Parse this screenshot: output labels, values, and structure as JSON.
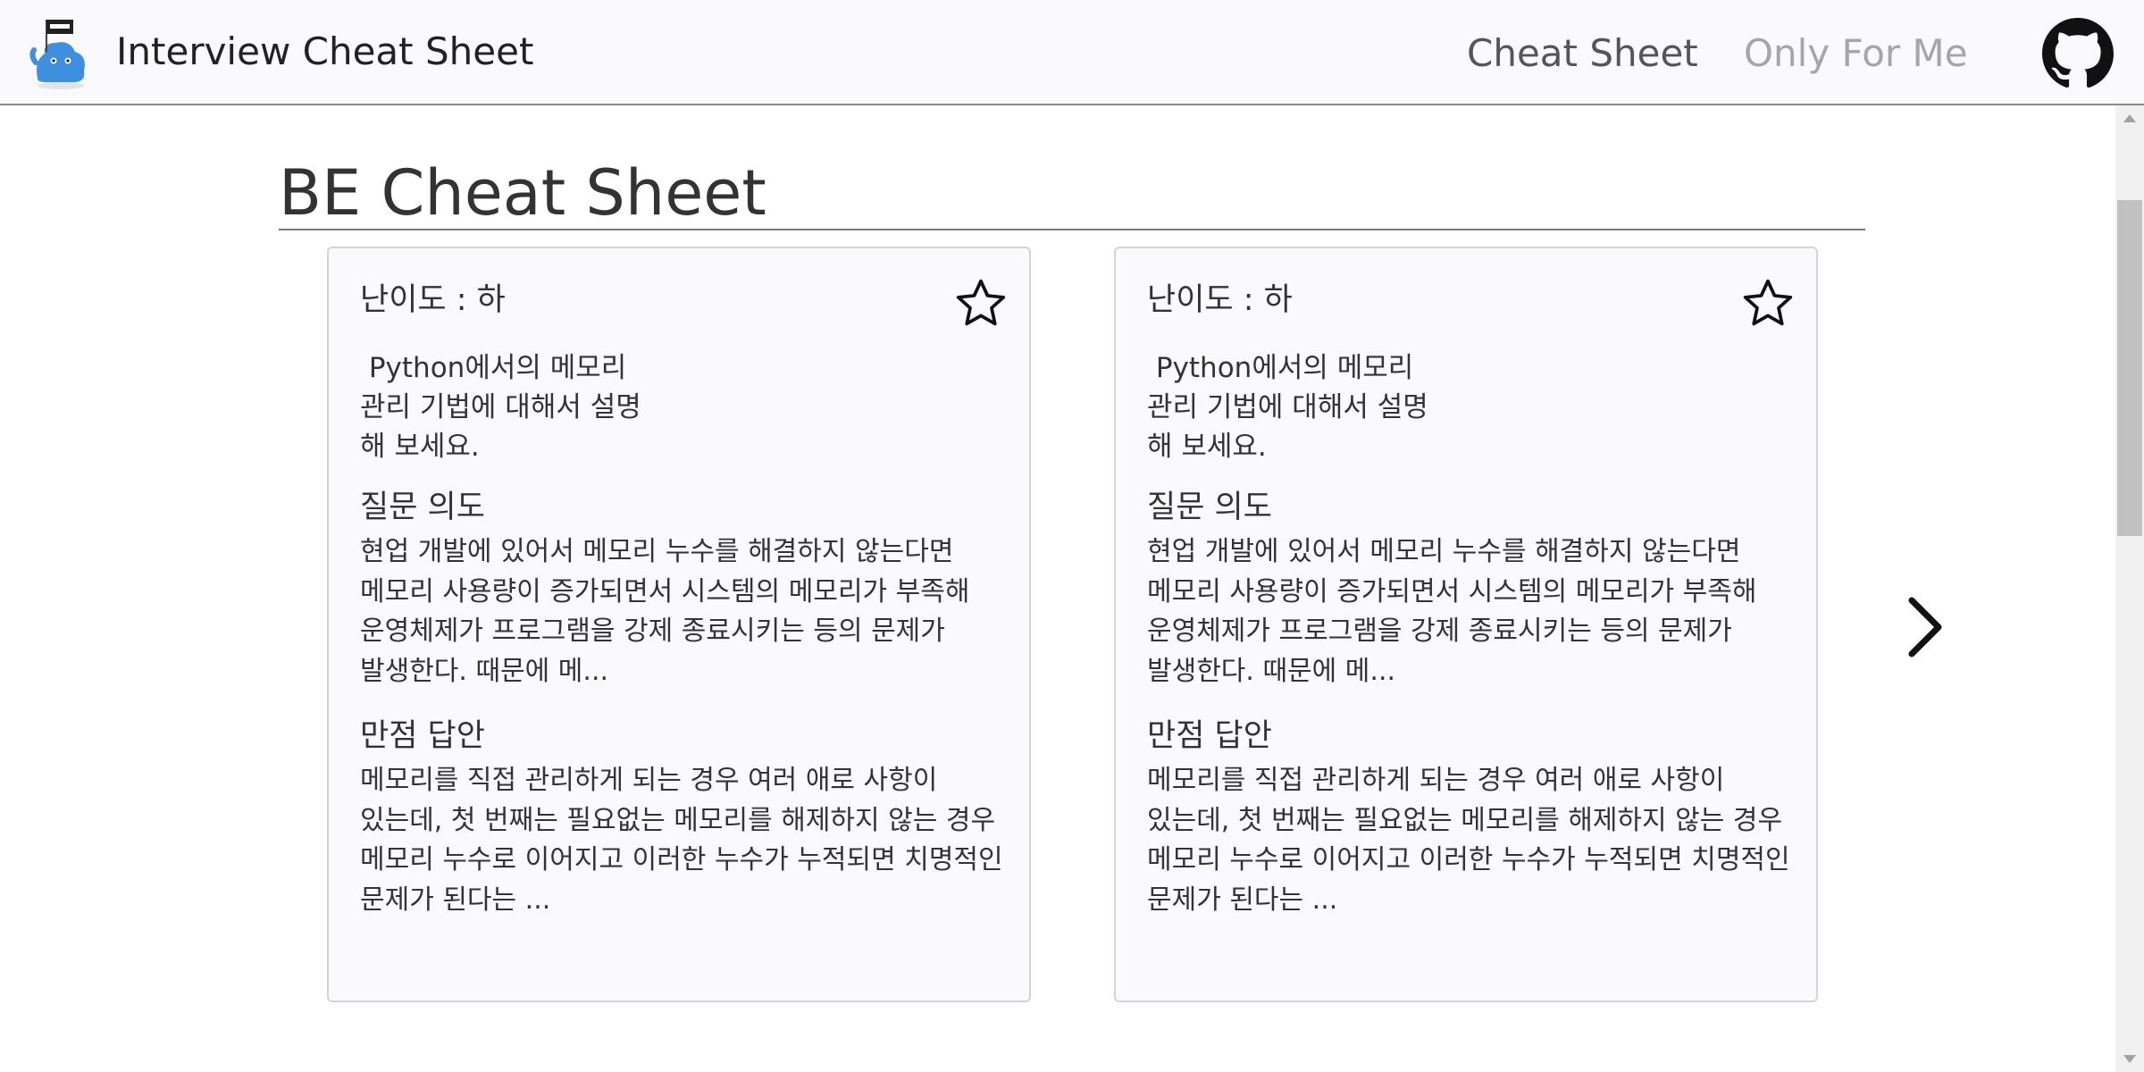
{
  "header": {
    "app_title": "Interview Cheat Sheet",
    "logo_icon": "blue-mascot-logo-icon",
    "nav": {
      "cheat_sheet": "Cheat Sheet",
      "only_for_me": "Only For Me"
    },
    "github_icon": "github-icon",
    "colors": {
      "active_nav": "#555555",
      "inactive_nav": "#a6a6a6",
      "mascot_blue": "#3d8fe0"
    }
  },
  "main": {
    "page_title": "BE Cheat Sheet",
    "cards": [
      {
        "difficulty": "난이도 : 하",
        "question": " Python에서의 메모리\n관리 기법에 대해서 설명\n해 보세요.",
        "intent_heading": "질문 의도",
        "intent_body": "현업 개발에 있어서 메모리 누수를 해결하지 않는다면 메모리 사용량이 증가되면서 시스템의 메모리가 부족해 운영체제가 프로그램을 강제 종료시키는 등의 문제가 발생한다. 때문에 메...",
        "answer_heading": "만점 답안",
        "answer_body": "메모리를 직접 관리하게 되는 경우 여러 애로 사항이 있는데, 첫 번째는 필요없는 메모리를 해제하지 않는 경우 메모리 누수로 이어지고 이러한 누수가 누적되면 치명적인 문제가 된다는 ...",
        "favorite_icon": "star-outline-icon"
      },
      {
        "difficulty": "난이도 : 하",
        "question": " Python에서의 메모리\n관리 기법에 대해서 설명\n해 보세요.",
        "intent_heading": "질문 의도",
        "intent_body": "현업 개발에 있어서 메모리 누수를 해결하지 않는다면 메모리 사용량이 증가되면서 시스템의 메모리가 부족해 운영체제가 프로그램을 강제 종료시키는 등의 문제가 발생한다. 때문에 메...",
        "answer_heading": "만점 답안",
        "answer_body": "메모리를 직접 관리하게 되는 경우 여러 애로 사항이 있는데, 첫 번째는 필요없는 메모리를 해제하지 않는 경우 메모리 누수로 이어지고 이러한 누수가 누적되면 치명적인 문제가 된다는 ...",
        "favorite_icon": "star-outline-icon"
      }
    ],
    "next_icon": "chevron-right-icon"
  }
}
